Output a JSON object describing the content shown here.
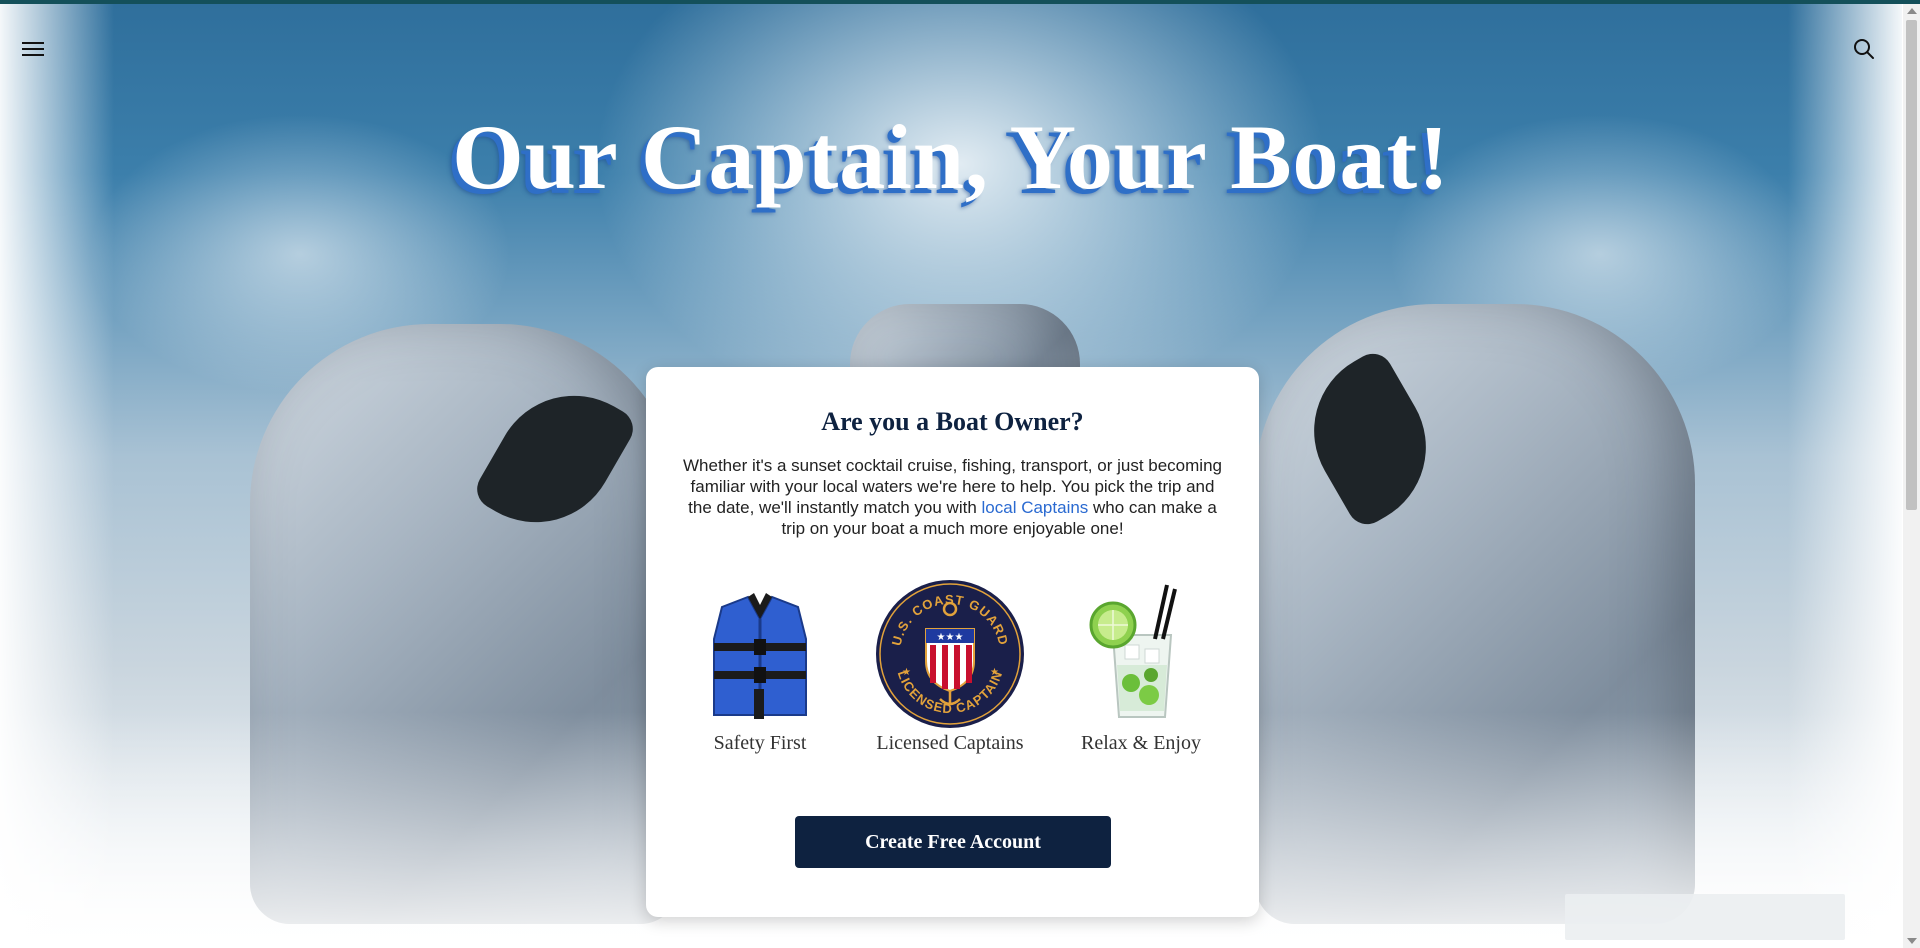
{
  "hero": {
    "title": "Our Captain, Your Boat!"
  },
  "header": {
    "menu_icon": "hamburger-menu-icon",
    "search_icon": "search-icon"
  },
  "card": {
    "title": "Are you a Boat Owner?",
    "body_before_link": "Whether it's a sunset cocktail cruise, fishing, transport, or just becoming familiar with your local waters we're here to help. You pick the trip and the date, we'll instantly match you with ",
    "link_text": "local Captains",
    "body_after_link": " who can make a trip on your boat a much more enjoyable one!",
    "features": [
      {
        "label": "Safety First",
        "icon": "life-jacket-icon"
      },
      {
        "label": "Licensed Captains",
        "icon": "coast-guard-badge-icon",
        "badge_text_top": "U.S. COAST GUARD",
        "badge_text_bottom": "LICENSED CAPTAIN"
      },
      {
        "label": "Relax & Enjoy",
        "icon": "cocktail-icon"
      }
    ],
    "cta_label": "Create Free Account"
  },
  "colors": {
    "topbar": "#14505a",
    "navy": "#0e2240",
    "link": "#2a6ad1",
    "title_shadow": "#2f6fc7"
  }
}
